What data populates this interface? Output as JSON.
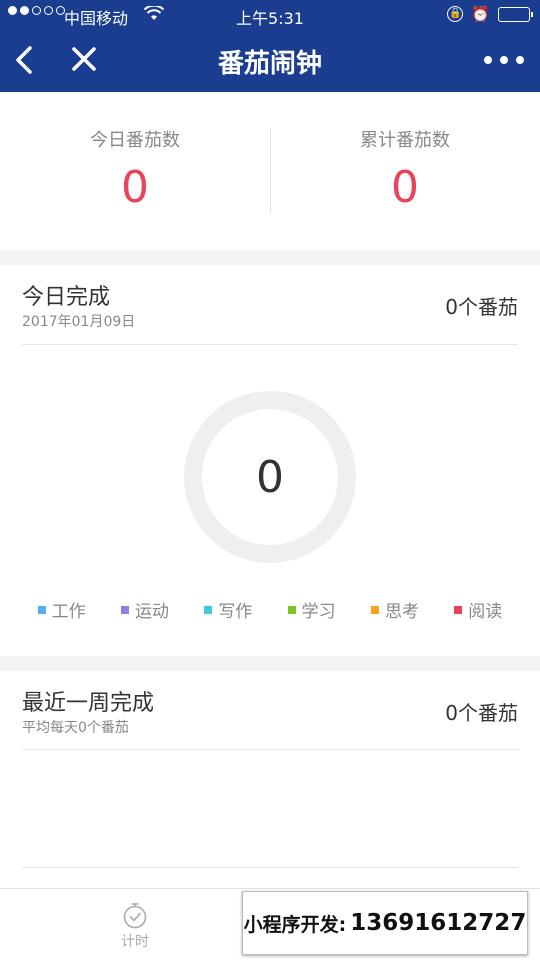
{
  "status_bar": {
    "signal_dots": [
      true,
      true,
      false,
      false,
      false
    ],
    "carrier": "中国移动",
    "time": "上午5:31"
  },
  "nav": {
    "title": "番茄闹钟"
  },
  "stats": {
    "today_label": "今日番茄数",
    "today_value": "0",
    "total_label": "累计番茄数",
    "total_value": "0"
  },
  "today": {
    "title": "今日完成",
    "date": "2017年01月09日",
    "count": "0个番茄",
    "ring_value": "0",
    "legend": [
      {
        "label": "工作",
        "color": "#5aacf0"
      },
      {
        "label": "运动",
        "color": "#8e7fe0"
      },
      {
        "label": "写作",
        "color": "#3ccbe3"
      },
      {
        "label": "学习",
        "color": "#7cc62d"
      },
      {
        "label": "思考",
        "color": "#f5a323"
      },
      {
        "label": "阅读",
        "color": "#e8435a"
      }
    ]
  },
  "week": {
    "title": "最近一周完成",
    "subtitle": "平均每天0个番茄",
    "count": "0个番茄"
  },
  "tabbar": {
    "timer_label": "计时"
  },
  "watermark": {
    "prefix": "小程序开发:",
    "phone": "13691612727"
  },
  "colors": {
    "nav_bg": "#1a3d8f",
    "accent_red": "#e8435a"
  }
}
